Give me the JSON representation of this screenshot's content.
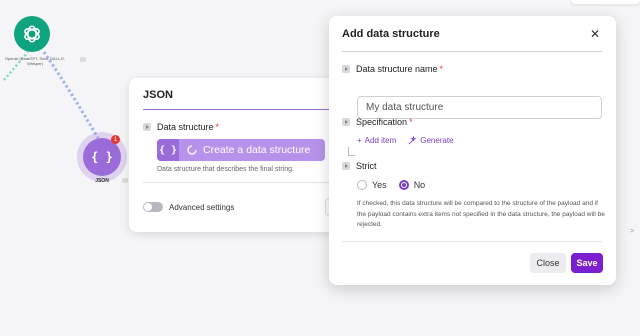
{
  "canvas": {
    "openai_node": {
      "icon": "openai-icon",
      "label": "OpenAI (ChatGPT, Sora, DALL-E, Whisper)",
      "color": "#10a37f"
    },
    "json_node": {
      "icon": "json-braces-icon",
      "label": "JSON",
      "badge": "1",
      "color": "#9b6bd9"
    }
  },
  "json_panel": {
    "title": "JSON",
    "data_structure_label": "Data structure",
    "create_button_label": "Create a data structure",
    "data_structure_help": "Data structure that describes the final string.",
    "advanced_settings_label": "Advanced settings"
  },
  "modal": {
    "title": "Add data structure",
    "name_label": "Data structure name",
    "name_value": "My data structure",
    "specification_label": "Specification",
    "add_item_label": "Add item",
    "generate_label": "Generate",
    "strict_label": "Strict",
    "strict_options": [
      {
        "label": "Yes",
        "selected": false
      },
      {
        "label": "No",
        "selected": true
      }
    ],
    "strict_help": "If checked, this data structure will be compared to the structure of the payload and if the payload contains extra items not specified in the data structure, the payload will be rejected.",
    "close_button": "Close",
    "save_button": "Save"
  },
  "colors": {
    "accent": "#7b1fd1",
    "link": "#7b3fc4",
    "required": "#e53935"
  }
}
